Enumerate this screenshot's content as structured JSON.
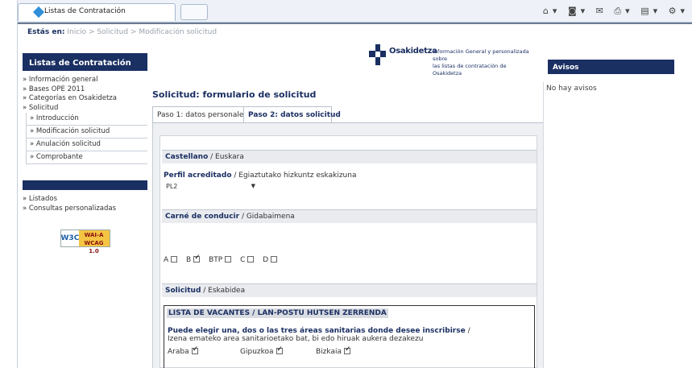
{
  "browser": {
    "tab_title": "Listas de Contratación",
    "toolbar_icons": [
      "home-icon",
      "rss-icon",
      "mail-icon",
      "print-icon",
      "page-icon",
      "tools-icon"
    ]
  },
  "breadcrumb": {
    "lead": "Estás en:",
    "path": "Inicio  > Solicitud > Modificación solicitud"
  },
  "logo": {
    "name": "Osakidetza",
    "description_line1": "Información General y personalizada sobre",
    "description_line2": "las listas de contratación de Osakidetza"
  },
  "sidebar": {
    "title": "Listas de Contratación",
    "items": [
      "» Información general",
      "» Bases OPE 2011",
      "» Categorías en Osakidetza",
      "» Solicitud"
    ],
    "subitems": [
      "» Introducción",
      "» Modificación solicitud",
      "» Anulación solicitud",
      "» Comprobante"
    ],
    "items2": [
      "» Listados",
      "» Consultas personalizadas"
    ],
    "badge_w3c": "W3C",
    "badge_wai": "WAI-A",
    "badge_wcag": "WCAG 1.0"
  },
  "avisos": {
    "title": "Avisos",
    "empty": "No hay avisos"
  },
  "form": {
    "title": "Solicitud: formulario de solicitud",
    "tab1": "Paso 1: datos personales",
    "tab2": "Paso 2: datos solicitud",
    "lang_section_bold": "Castellano",
    "lang_section_rest": " / Euskara",
    "perfil_bold": "Perfil acreditado",
    "perfil_rest": " / Egiaztutako hizkuntz eskakizuna",
    "perfil_value": "PL2",
    "carne_bold": "Carné de conducir",
    "carne_rest": " / Gidabaimena",
    "licenses": [
      {
        "label": "A",
        "checked": false
      },
      {
        "label": "B",
        "checked": true
      },
      {
        "label": "BTP",
        "checked": false
      },
      {
        "label": "C",
        "checked": false
      },
      {
        "label": "D",
        "checked": false
      }
    ],
    "solicitud_bold": "Solicitud",
    "solicitud_rest": " / Eskabidea",
    "vacantes_title": "LISTA DE VACANTES / LAN-POSTU HUTSEN ZERRENDA",
    "question_bold": "Puede elegir una, dos o las tres áreas sanitarias donde desee inscribirse",
    "question_rest": " /",
    "question_line2": "Izena emateko area sanitarioetako bat, bi edo hiruak aukera dezakezu",
    "areas": [
      {
        "label": "Araba",
        "checked": true
      },
      {
        "label": "Gipuzkoa",
        "checked": true
      },
      {
        "label": "Bizkaia",
        "checked": true
      }
    ]
  }
}
